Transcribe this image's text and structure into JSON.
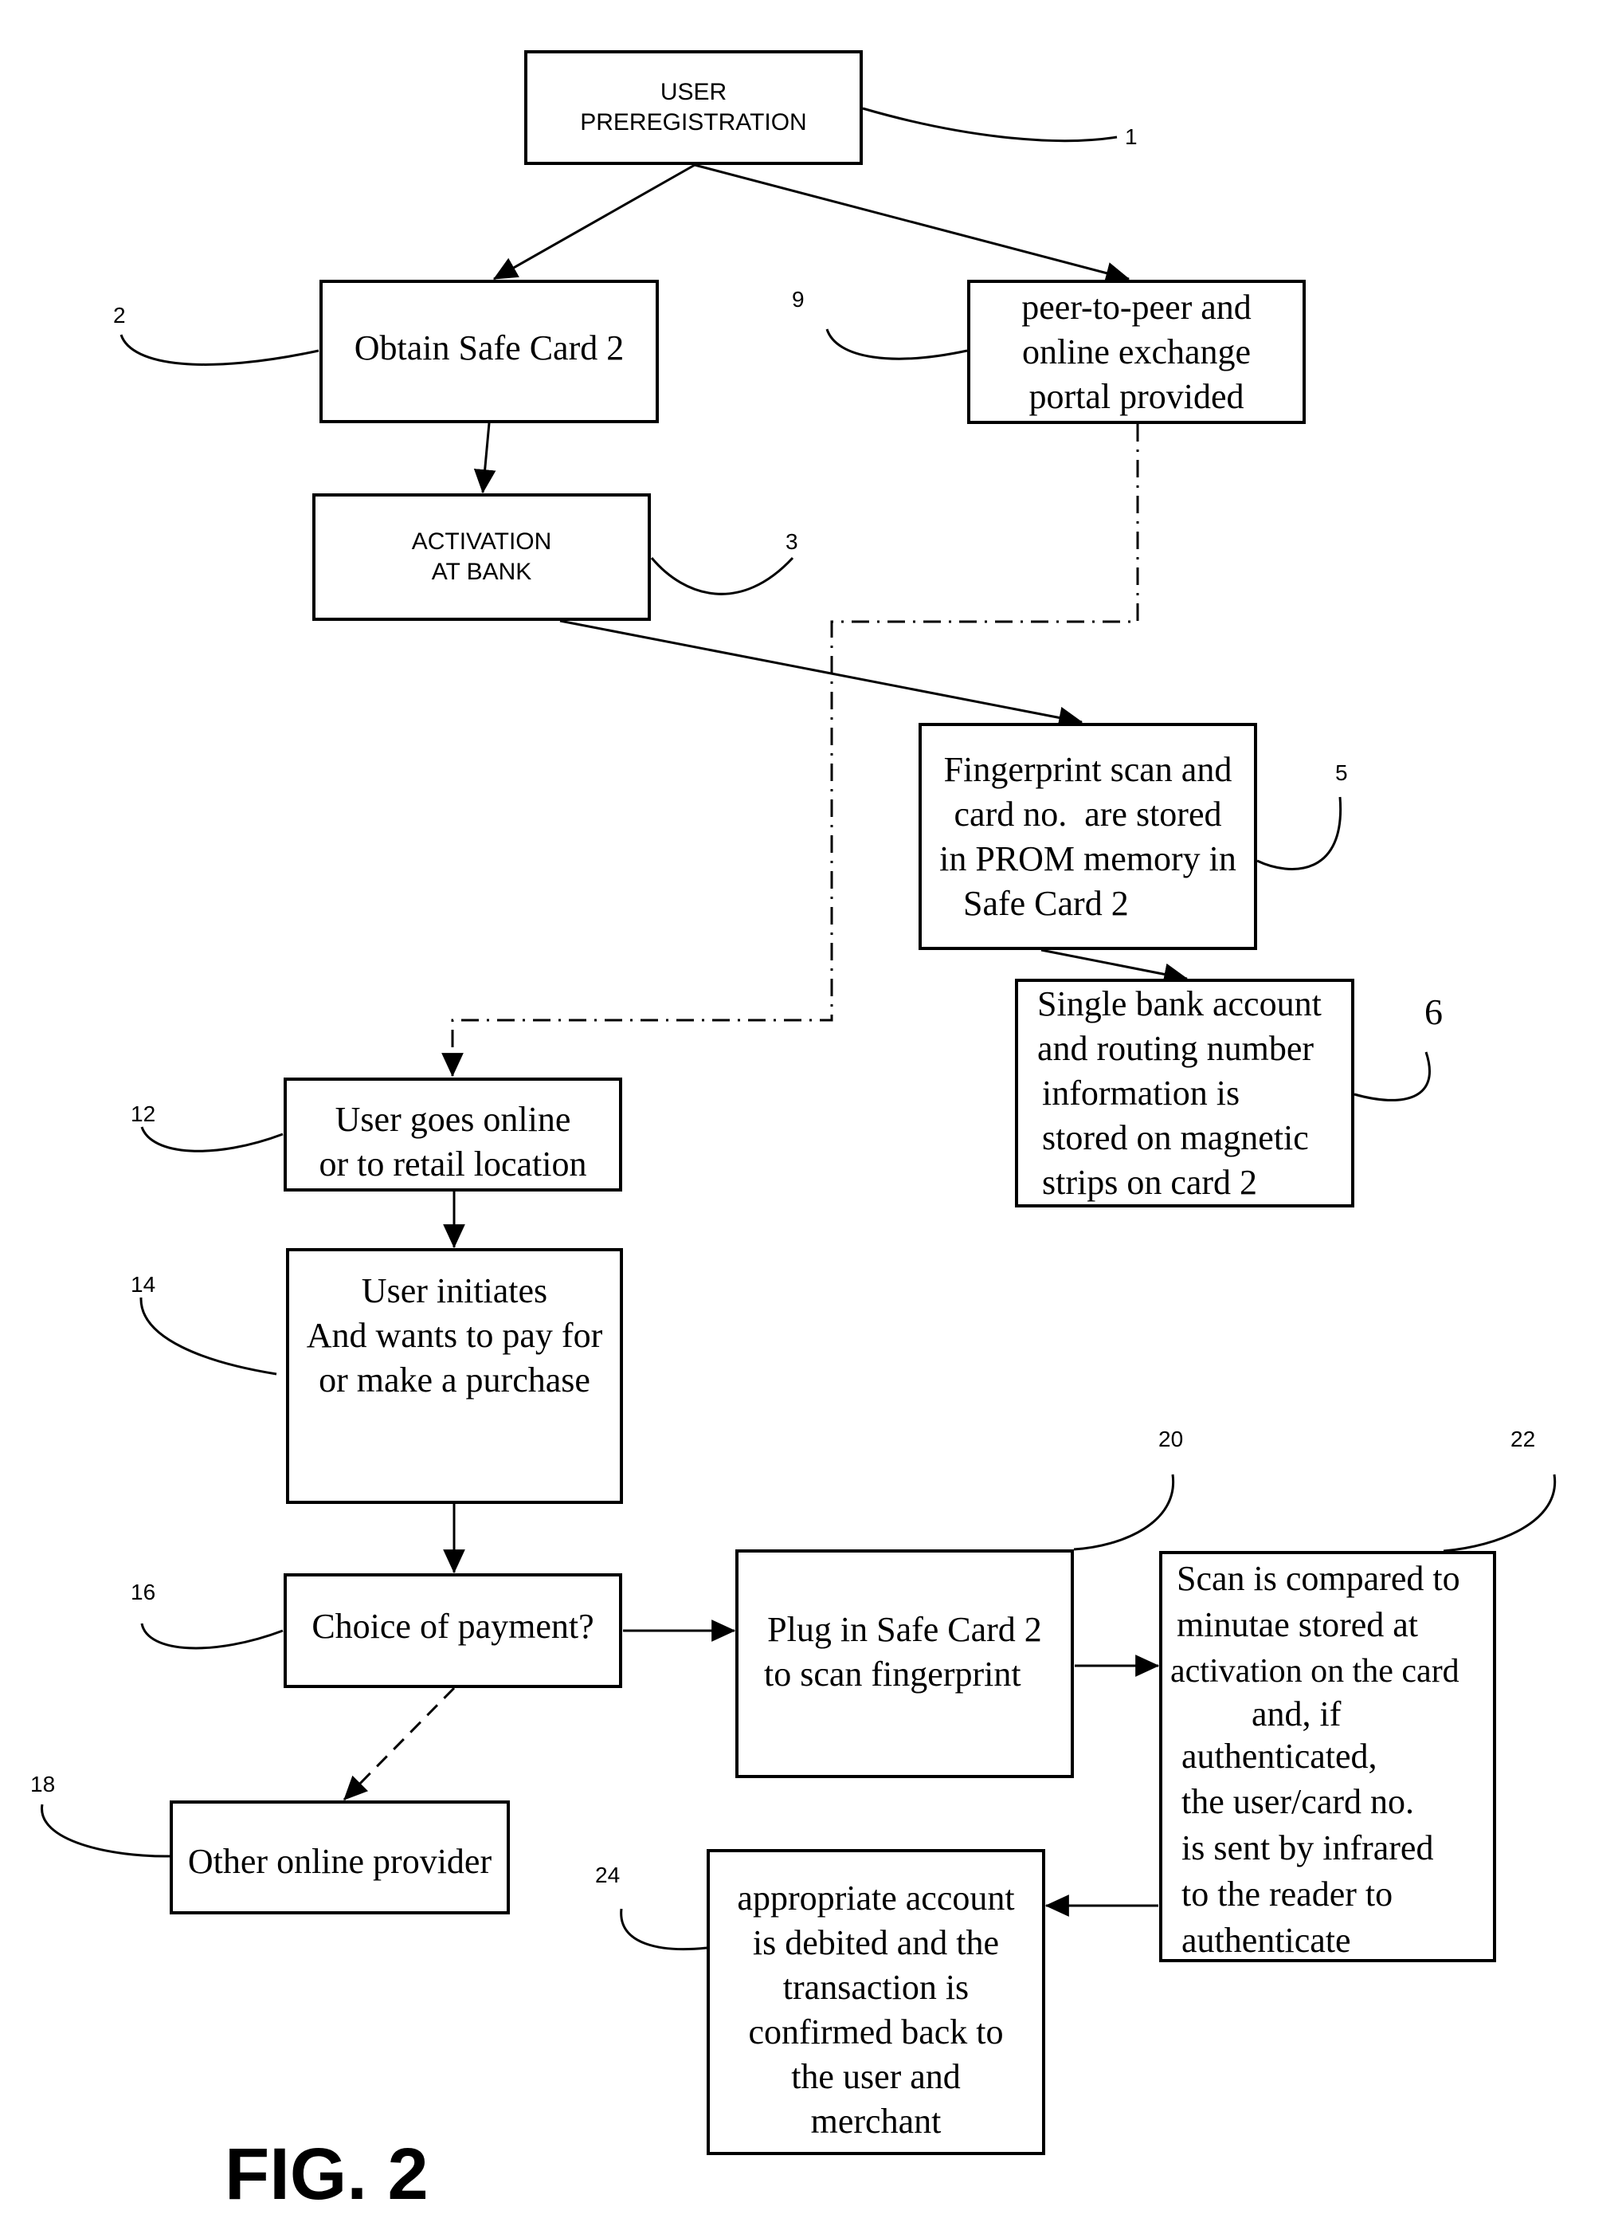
{
  "figure": {
    "caption": "FIG. 2"
  },
  "nodes": {
    "user_preregistration": {
      "ref": "1",
      "lines": [
        "USER",
        "PREREGISTRATION"
      ]
    },
    "obtain_safe_card": {
      "ref": "2",
      "lines": [
        "Obtain Safe Card 2"
      ]
    },
    "activation_at_bank": {
      "ref": "3",
      "lines": [
        "ACTIVATION",
        "AT BANK"
      ]
    },
    "fingerprint_stored": {
      "ref": "5",
      "lines": [
        "Fingerprint scan and",
        "card no.  are stored",
        "in PROM memory in",
        "Safe Card 2"
      ]
    },
    "bank_account_stored": {
      "ref": "6",
      "lines": [
        "Single bank account",
        "and routing number",
        "information is",
        "stored on magnetic",
        "strips on card 2"
      ]
    },
    "p2p_portal": {
      "ref": "9",
      "lines": [
        "peer-to-peer and",
        "online exchange",
        "portal provided"
      ]
    },
    "user_goes_online": {
      "ref": "12",
      "lines": [
        "User goes online",
        "or to retail location"
      ]
    },
    "user_initiates": {
      "ref": "14",
      "lines": [
        "User initiates",
        "And wants to pay for",
        "or make a purchase"
      ]
    },
    "choice_of_payment": {
      "ref": "16",
      "lines": [
        "Choice of payment?"
      ]
    },
    "other_online_provider": {
      "ref": "18",
      "lines": [
        "Other online provider"
      ]
    },
    "plug_in_safe_card": {
      "ref": "20",
      "lines": [
        "Plug in Safe Card 2",
        "to scan fingerprint"
      ]
    },
    "scan_compared": {
      "ref": "22",
      "lines": [
        "Scan is compared to",
        "minutae stored at",
        "activation on the card",
        "and, if",
        "authenticated,",
        "the user/card no.",
        "is sent by infrared",
        "to the reader to",
        "authenticate"
      ]
    },
    "account_debited": {
      "ref": "24",
      "lines": [
        "appropriate account",
        "is debited and the",
        "transaction is",
        "confirmed back to",
        "the user and",
        "merchant"
      ]
    }
  },
  "edges": [
    {
      "from": "user_preregistration",
      "to": "obtain_safe_card",
      "style": "solid"
    },
    {
      "from": "user_preregistration",
      "to": "p2p_portal",
      "style": "solid"
    },
    {
      "from": "obtain_safe_card",
      "to": "activation_at_bank",
      "style": "solid"
    },
    {
      "from": "activation_at_bank",
      "to": "fingerprint_stored",
      "style": "solid"
    },
    {
      "from": "fingerprint_stored",
      "to": "bank_account_stored",
      "style": "solid"
    },
    {
      "from": "p2p_portal",
      "to": "user_goes_online",
      "style": "dash-dot"
    },
    {
      "from": "user_goes_online",
      "to": "user_initiates",
      "style": "solid"
    },
    {
      "from": "user_initiates",
      "to": "choice_of_payment",
      "style": "solid"
    },
    {
      "from": "choice_of_payment",
      "to": "plug_in_safe_card",
      "style": "solid"
    },
    {
      "from": "choice_of_payment",
      "to": "other_online_provider",
      "style": "dashed"
    },
    {
      "from": "plug_in_safe_card",
      "to": "scan_compared",
      "style": "solid"
    },
    {
      "from": "scan_compared",
      "to": "account_debited",
      "style": "solid"
    }
  ]
}
